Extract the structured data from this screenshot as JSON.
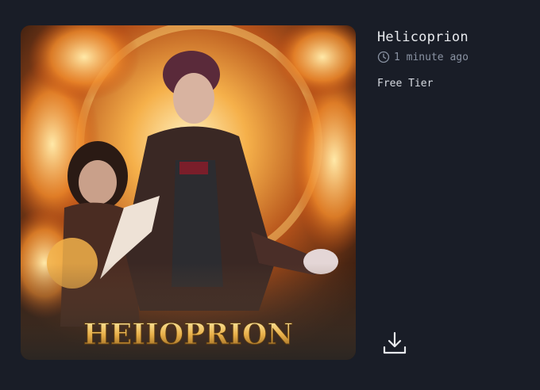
{
  "card": {
    "title": "Helicoprion",
    "timestamp": "1 minute ago",
    "tier": "Free Tier",
    "image": {
      "subject": "AI-generated fantasy poster: two figures amid flames",
      "poster_text": "HEIIOPRION"
    },
    "icons": {
      "clock": "clock-icon",
      "download": "download-icon"
    }
  },
  "colors": {
    "background": "#191d27",
    "text_primary": "#e8eaee",
    "text_muted": "#8a93a3"
  }
}
